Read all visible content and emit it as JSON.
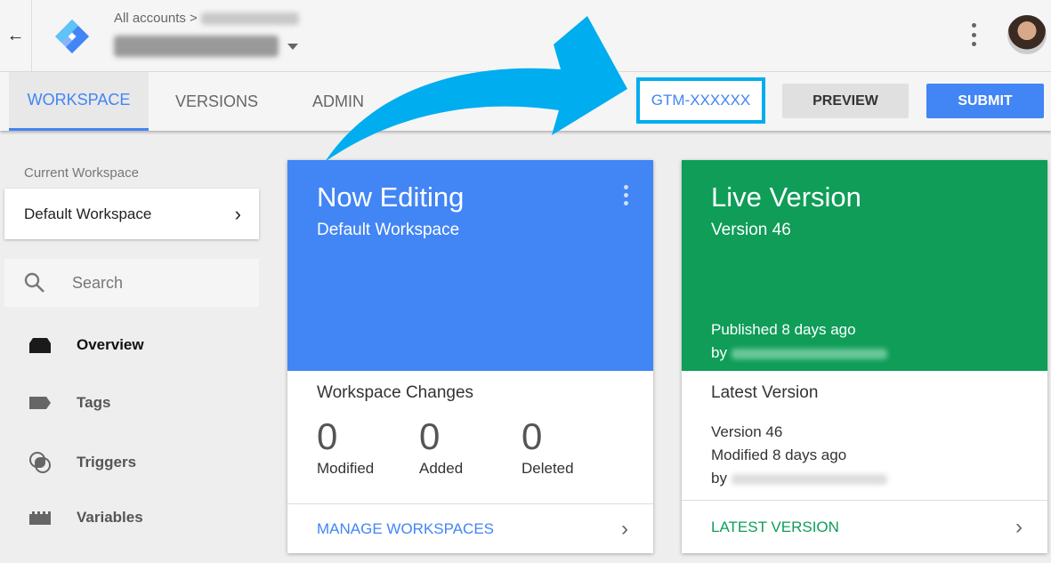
{
  "header": {
    "breadcrumb_root": "All accounts",
    "back_icon": "arrow-left-icon",
    "logo": "google-tag-manager-logo"
  },
  "tabs": [
    {
      "label": "WORKSPACE",
      "active": true
    },
    {
      "label": "VERSIONS"
    },
    {
      "label": "ADMIN"
    }
  ],
  "container_id": "GTM-XXXXXX",
  "actions": {
    "preview": "PREVIEW",
    "submit": "SUBMIT"
  },
  "sidebar": {
    "current_workspace_label": "Current Workspace",
    "workspace": "Default Workspace",
    "search_placeholder": "Search",
    "items": [
      {
        "label": "Overview",
        "icon": "overview-icon",
        "active": true
      },
      {
        "label": "Tags",
        "icon": "tag-icon"
      },
      {
        "label": "Triggers",
        "icon": "trigger-icon"
      },
      {
        "label": "Variables",
        "icon": "variables-icon"
      }
    ]
  },
  "editing_card": {
    "title": "Now Editing",
    "subtitle": "Default Workspace",
    "section": "Workspace Changes",
    "stats": [
      {
        "value": "0",
        "label": "Modified"
      },
      {
        "value": "0",
        "label": "Added"
      },
      {
        "value": "0",
        "label": "Deleted"
      }
    ],
    "footer": "MANAGE WORKSPACES",
    "color": "#4285f4"
  },
  "live_card": {
    "title": "Live Version",
    "subtitle": "Version 46",
    "published": "Published 8 days ago",
    "by": "by",
    "section": "Latest Version",
    "version": "Version 46",
    "modified": "Modified 8 days ago",
    "footer": "LATEST VERSION",
    "color": "#0f9d58"
  },
  "annotation": {
    "arrow_color": "#00adef"
  }
}
